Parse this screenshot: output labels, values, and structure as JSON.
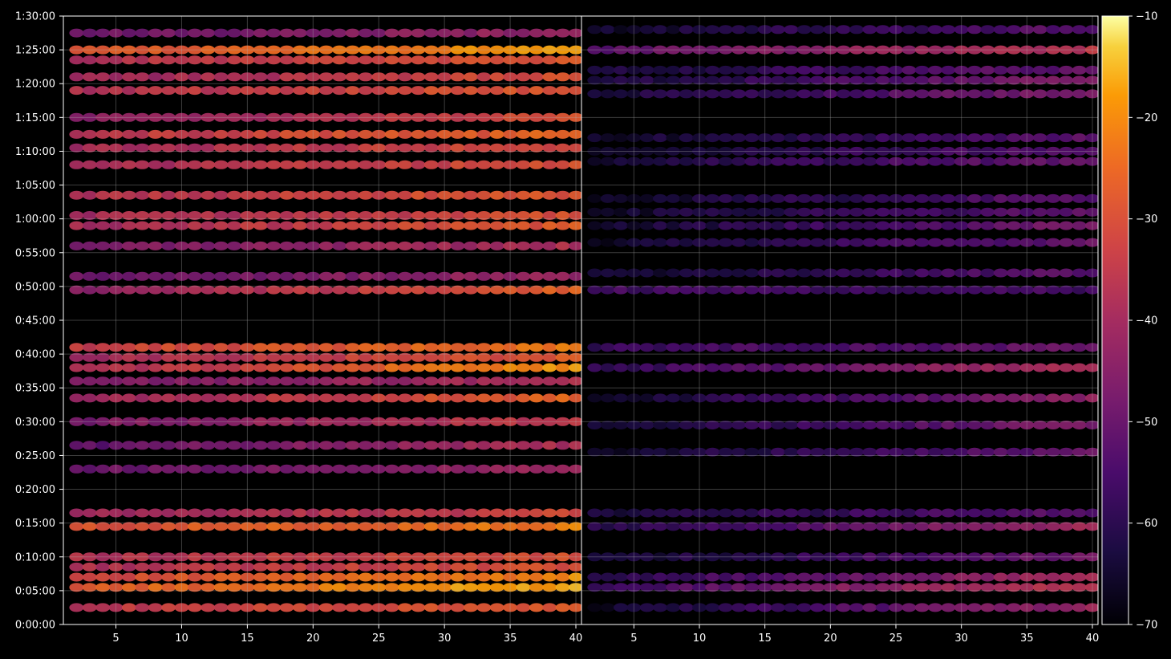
{
  "chart_data": {
    "type": "heatmap",
    "title": "",
    "xlabel": "",
    "ylabel": "",
    "colormap": "inferno",
    "background": "#000000",
    "grid": true,
    "panels": [
      {
        "name": "",
        "xlim": [
          1,
          40
        ],
        "xticks": [
          5,
          10,
          15,
          20,
          25,
          30,
          35,
          40
        ],
        "bands": [
          {
            "t": "0:02:30",
            "lo": -36,
            "hi": -28
          },
          {
            "t": "0:05:30",
            "lo": -28,
            "hi": -16
          },
          {
            "t": "0:07:00",
            "lo": -32,
            "hi": -20
          },
          {
            "t": "0:08:30",
            "lo": -38,
            "hi": -30
          },
          {
            "t": "0:10:00",
            "lo": -38,
            "hi": -30
          },
          {
            "t": "0:14:30",
            "lo": -30,
            "hi": -22
          },
          {
            "t": "0:16:30",
            "lo": -42,
            "hi": -32
          },
          {
            "t": "0:23:00",
            "lo": -50,
            "hi": -42
          },
          {
            "t": "0:26:30",
            "lo": -52,
            "hi": -38
          },
          {
            "t": "0:30:00",
            "lo": -48,
            "hi": -34
          },
          {
            "t": "0:33:30",
            "lo": -42,
            "hi": -26
          },
          {
            "t": "0:36:00",
            "lo": -48,
            "hi": -38
          },
          {
            "t": "0:38:00",
            "lo": -40,
            "hi": -18
          },
          {
            "t": "0:39:30",
            "lo": -40,
            "hi": -28
          },
          {
            "t": "0:41:00",
            "lo": -34,
            "hi": -22
          },
          {
            "t": "0:49:30",
            "lo": -45,
            "hi": -26
          },
          {
            "t": "0:51:30",
            "lo": -50,
            "hi": -42
          },
          {
            "t": "0:56:00",
            "lo": -48,
            "hi": -38
          },
          {
            "t": "0:59:00",
            "lo": -40,
            "hi": -28
          },
          {
            "t": "1:00:30",
            "lo": -40,
            "hi": -30
          },
          {
            "t": "1:03:30",
            "lo": -38,
            "hi": -28
          },
          {
            "t": "1:08:00",
            "lo": -40,
            "hi": -30
          },
          {
            "t": "1:10:30",
            "lo": -40,
            "hi": -30
          },
          {
            "t": "1:12:30",
            "lo": -36,
            "hi": -26
          },
          {
            "t": "1:15:00",
            "lo": -45,
            "hi": -30
          },
          {
            "t": "1:19:00",
            "lo": -38,
            "hi": -28
          },
          {
            "t": "1:21:00",
            "lo": -42,
            "hi": -30
          },
          {
            "t": "1:23:30",
            "lo": -38,
            "hi": -28
          },
          {
            "t": "1:25:00",
            "lo": -30,
            "hi": -18
          },
          {
            "t": "1:27:30",
            "lo": -50,
            "hi": -42
          }
        ]
      },
      {
        "name": "",
        "xlim": [
          1,
          40
        ],
        "xticks": [
          5,
          10,
          15,
          20,
          25,
          30,
          35,
          40
        ],
        "bands": [
          {
            "t": "0:02:30",
            "lo": -66,
            "hi": -42
          },
          {
            "t": "0:05:30",
            "lo": -58,
            "hi": -34
          },
          {
            "t": "0:07:00",
            "lo": -60,
            "hi": -40
          },
          {
            "t": "0:10:00",
            "lo": -66,
            "hi": -48
          },
          {
            "t": "0:14:30",
            "lo": -62,
            "hi": -40
          },
          {
            "t": "0:16:30",
            "lo": -64,
            "hi": -52
          },
          {
            "t": "0:25:30",
            "lo": -66,
            "hi": -50
          },
          {
            "t": "0:29:30",
            "lo": -66,
            "hi": -46
          },
          {
            "t": "0:33:30",
            "lo": -66,
            "hi": -44
          },
          {
            "t": "0:38:00",
            "lo": -60,
            "hi": -38
          },
          {
            "t": "0:41:00",
            "lo": -58,
            "hi": -50
          },
          {
            "t": "0:49:30",
            "lo": -56,
            "hi": -56
          },
          {
            "t": "0:52:00",
            "lo": -66,
            "hi": -52
          },
          {
            "t": "0:56:30",
            "lo": -66,
            "hi": -50
          },
          {
            "t": "0:59:00",
            "lo": -66,
            "hi": -48
          },
          {
            "t": "1:01:00",
            "lo": -66,
            "hi": -52
          },
          {
            "t": "1:03:00",
            "lo": -66,
            "hi": -52
          },
          {
            "t": "1:08:30",
            "lo": -64,
            "hi": -50
          },
          {
            "t": "1:10:00",
            "lo": -66,
            "hi": -52
          },
          {
            "t": "1:12:00",
            "lo": -66,
            "hi": -52
          },
          {
            "t": "1:18:30",
            "lo": -64,
            "hi": -46
          },
          {
            "t": "1:20:30",
            "lo": -64,
            "hi": -46
          },
          {
            "t": "1:22:00",
            "lo": -64,
            "hi": -50
          },
          {
            "t": "1:25:00",
            "lo": -52,
            "hi": -36
          },
          {
            "t": "1:28:00",
            "lo": -66,
            "hi": -52
          }
        ]
      }
    ],
    "y_axis": {
      "min": "0:00:00",
      "max": "1:30:00",
      "ticks": [
        "0:00:00",
        "0:05:00",
        "0:10:00",
        "0:15:00",
        "0:20:00",
        "0:25:00",
        "0:30:00",
        "0:35:00",
        "0:40:00",
        "0:45:00",
        "0:50:00",
        "0:55:00",
        "1:00:00",
        "1:05:00",
        "1:10:00",
        "1:15:00",
        "1:20:00",
        "1:25:00",
        "1:30:00"
      ]
    },
    "colorbar": {
      "min": -70,
      "max": -10,
      "ticks": [
        "−70",
        "−60",
        "−50",
        "−40",
        "−30",
        "−20",
        "−10"
      ]
    }
  }
}
